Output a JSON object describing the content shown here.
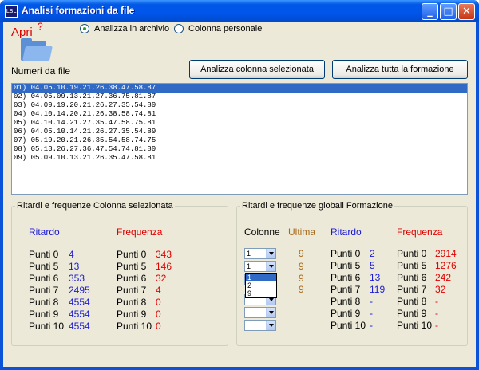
{
  "window": {
    "title": "Analisi formazioni da file",
    "icon_text": "LBL"
  },
  "titlebar_buttons": {
    "minimize": "_",
    "maximize": "□",
    "close": "✕"
  },
  "open": {
    "label": "Apri",
    "help": "?"
  },
  "options": [
    {
      "label": "Analizza in archivio",
      "selected": true
    },
    {
      "label": "Colonna personale",
      "selected": false
    }
  ],
  "numbers_label": "Numeri da file",
  "buttons": {
    "analyze_column": "Analizza colonna selezionata",
    "analyze_all": "Analizza tutta la formazione"
  },
  "list": [
    "01) 04.05.10.19.21.26.38.47.58.87",
    "02) 04.05.09.13.21.27.36.75.81.87",
    "03) 04.09.19.20.21.26.27.35.54.89",
    "04) 04.10.14.20.21.26.38.58.74.81",
    "05) 04.10.14.21.27.35.47.58.75.81",
    "06) 04.05.10.14.21.26.27.35.54.89",
    "07) 05.19.20.21.26.35.54.58.74.75",
    "08) 05.13.26.27.36.47.54.74.81.89",
    "09) 05.09.10.13.21.26.35.47.58.81"
  ],
  "left_group": {
    "title": "Ritardi e frequenze Colonna selezionata",
    "ritardo_header": "Ritardo",
    "frequenza_header": "Frequenza",
    "ritardo_rows": [
      {
        "label": "Punti 0",
        "value": "4"
      },
      {
        "label": "Punti 5",
        "value": "13"
      },
      {
        "label": "Punti 6",
        "value": "353"
      },
      {
        "label": "Punti 7",
        "value": "2495"
      },
      {
        "label": "Punti 8",
        "value": "4554"
      },
      {
        "label": "Punti 9",
        "value": "4554"
      },
      {
        "label": "Punti 10",
        "value": "4554"
      }
    ],
    "frequenza_rows": [
      {
        "label": "Punti 0",
        "value": "343"
      },
      {
        "label": "Punti 5",
        "value": "146"
      },
      {
        "label": "Punti 6",
        "value": "32"
      },
      {
        "label": "Punti 7",
        "value": "4"
      },
      {
        "label": "Punti 8",
        "value": "0"
      },
      {
        "label": "Punti 9",
        "value": "0"
      },
      {
        "label": "Punti 10",
        "value": "0"
      }
    ]
  },
  "right_group": {
    "title": "Ritardi e frequenze globali Formazione",
    "colonne_header": "Colonne",
    "ultima_header": "Ultima",
    "ritardo_header": "Ritardo",
    "frequenza_header": "Frequenza",
    "combos": [
      {
        "value": "1"
      },
      {
        "value": "1"
      },
      {
        "value": ""
      },
      {
        "value": ""
      },
      {
        "value": ""
      },
      {
        "value": ""
      }
    ],
    "dropdown_options": [
      "1",
      "2",
      "9"
    ],
    "ultima": [
      "9",
      "9",
      "9",
      "9"
    ],
    "ritardo_rows": [
      {
        "label": "Punti 0",
        "value": "2"
      },
      {
        "label": "Punti 5",
        "value": "5"
      },
      {
        "label": "Punti 6",
        "value": "13"
      },
      {
        "label": "Punti 7",
        "value": "119"
      },
      {
        "label": "Punti 8",
        "value": "-"
      },
      {
        "label": "Punti 9",
        "value": "-"
      },
      {
        "label": "Punti 10",
        "value": "-"
      }
    ],
    "frequenza_rows": [
      {
        "label": "Punti 0",
        "value": "2914"
      },
      {
        "label": "Punti 5",
        "value": "1276"
      },
      {
        "label": "Punti 6",
        "value": "242"
      },
      {
        "label": "Punti 7",
        "value": "32"
      },
      {
        "label": "Punti 8",
        "value": "-"
      },
      {
        "label": "Punti 9",
        "value": "-"
      },
      {
        "label": "Punti 10",
        "value": "-"
      }
    ]
  }
}
